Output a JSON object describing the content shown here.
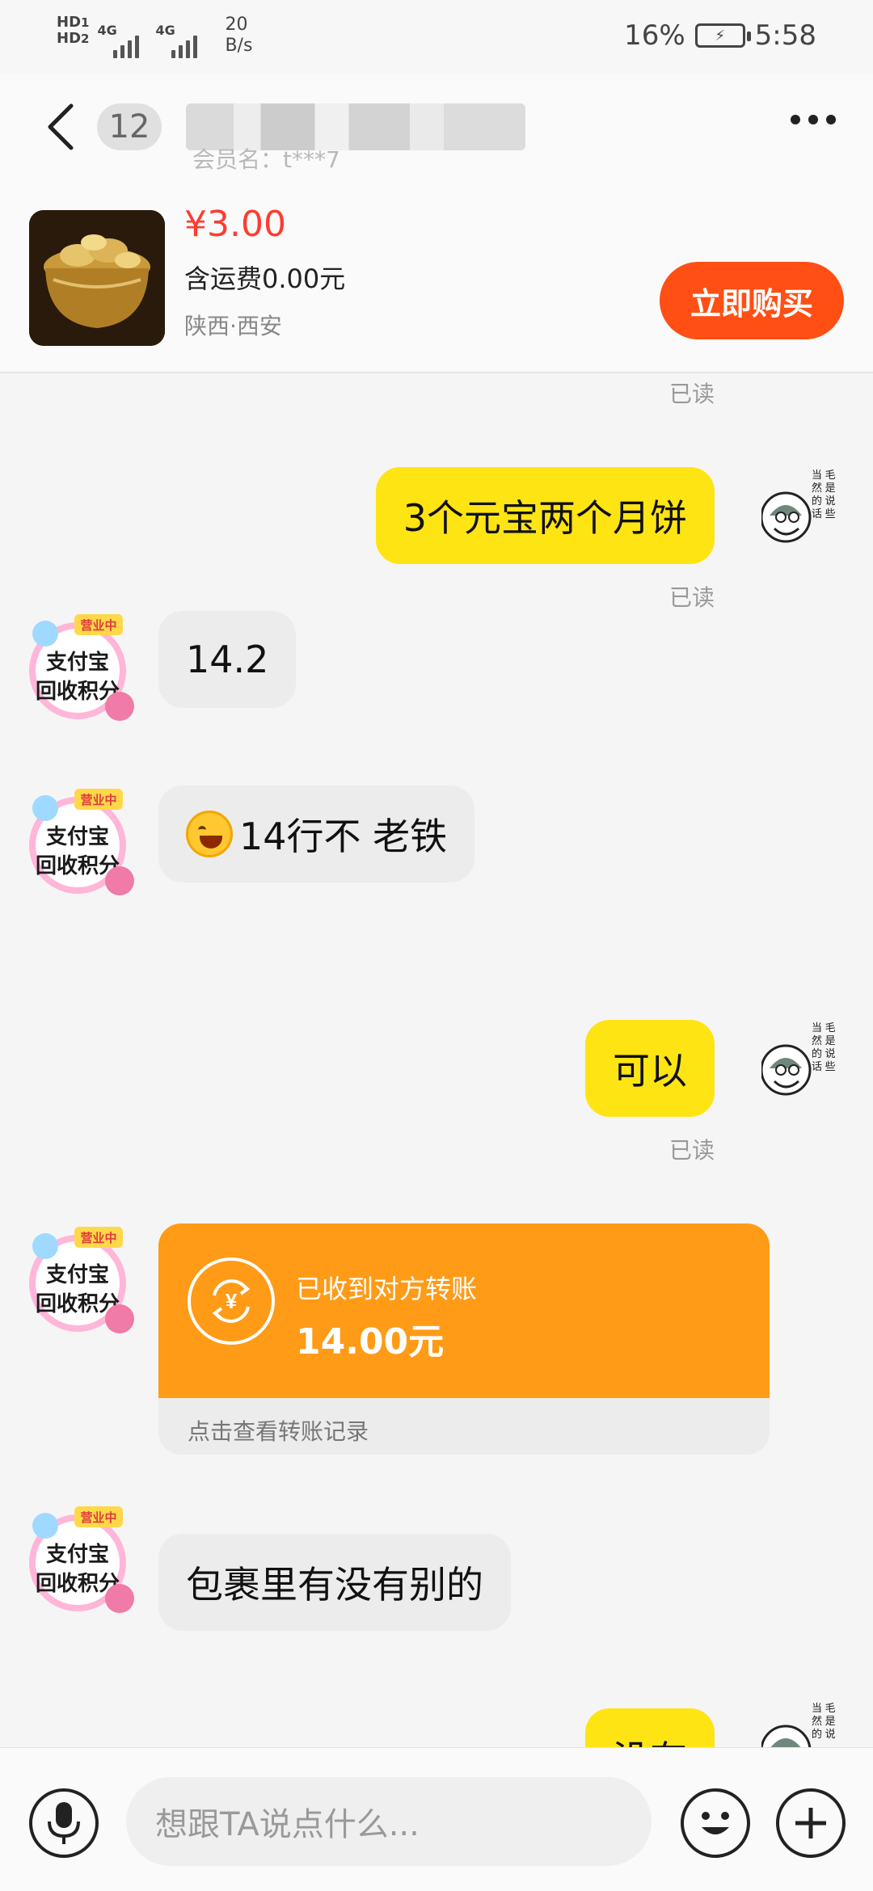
{
  "status_bar": {
    "hd1": "HD",
    "hd1_sub": "1",
    "hd2": "HD",
    "hd2_sub": "2",
    "network1": "4G",
    "network2": "4G",
    "speed_value": "20",
    "speed_unit": "B/s",
    "battery_percent": "16%",
    "time": "5:58"
  },
  "header": {
    "title_prefix": "12",
    "member_label": "会员名：t***7",
    "more_icon": "more-icon",
    "back_icon": "back-chevron-icon"
  },
  "product": {
    "price": "¥3.00",
    "shipping": "含运费0.00元",
    "location": "陕西·西安",
    "buy_label": "立即购买"
  },
  "chat": {
    "read_label": "已读",
    "messages": [
      {
        "side": "right",
        "text": "3个元宝两个月饼"
      },
      {
        "side": "left",
        "text": "14.2"
      },
      {
        "side": "left",
        "text": "14行不  老铁",
        "emoji": "laughing-emoji"
      },
      {
        "side": "right",
        "text": "可以"
      },
      {
        "side": "left",
        "type": "transfer"
      },
      {
        "side": "left",
        "text": "包裹里有没有别的"
      },
      {
        "side": "right",
        "text": "没有"
      }
    ],
    "transfer": {
      "title": "已收到对方转账",
      "amount": "14.00元",
      "link": "点击查看转账记录"
    },
    "left_avatar_text": {
      "line1": "支付宝",
      "line2": "回收积分",
      "badge": "营业中"
    },
    "right_avatar_text": "要挨当然的话,毛是说些了！"
  },
  "input_bar": {
    "placeholder": "想跟TA说点什么..."
  },
  "colors": {
    "accent_buy": "#ff4f14",
    "price_red": "#ff3b30",
    "bubble_yellow": "#ffe414",
    "transfer_orange": "#ff9b16"
  }
}
